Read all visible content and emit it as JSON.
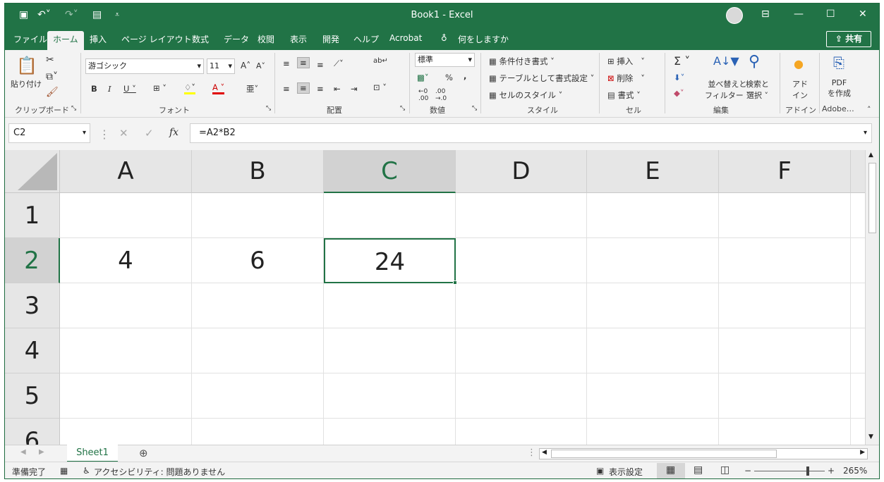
{
  "titlebar": {
    "title": "Book1 - Excel"
  },
  "menu": {
    "tabs": [
      "ファイル",
      "ホーム",
      "挿入",
      "ページ レイアウト",
      "数式",
      "データ",
      "校閲",
      "表示",
      "開発",
      "ヘルプ",
      "Acrobat"
    ],
    "tell_me": "何をしますか",
    "share": "共有"
  },
  "ribbon": {
    "clipboard": {
      "paste": "貼り付け",
      "label": "クリップボード"
    },
    "font": {
      "name": "游ゴシック",
      "size": "11",
      "label": "フォント"
    },
    "alignment": {
      "label": "配置"
    },
    "number": {
      "format": "標準",
      "label": "数値"
    },
    "styles": {
      "conditional": "条件付き書式",
      "table": "テーブルとして書式設定",
      "cell": "セルのスタイル",
      "label": "スタイル"
    },
    "cells": {
      "insert": "挿入",
      "delete": "削除",
      "format": "書式",
      "label": "セル"
    },
    "editing": {
      "sort1": "並べ替えと",
      "sort2": "フィルター",
      "find1": "検索と",
      "find2": "選択",
      "label": "編集"
    },
    "addins": {
      "line1": "アド",
      "line2": "イン",
      "label": "アドイン"
    },
    "adobe": {
      "line1": "PDF",
      "line2": "を作成",
      "label": "Adobe…"
    }
  },
  "formula_bar": {
    "name_box": "C2",
    "fx": "fx",
    "formula": "=A2*B2"
  },
  "sheet": {
    "columns": [
      "A",
      "B",
      "C",
      "D",
      "E",
      "F"
    ],
    "rows": [
      "1",
      "2",
      "3",
      "4",
      "5",
      "6"
    ],
    "cells": {
      "A2": "4",
      "B2": "6",
      "C2": "24"
    },
    "selected_cell": "C2"
  },
  "sheet_tabs": {
    "active": "Sheet1"
  },
  "status": {
    "ready": "準備完了",
    "accessibility": "アクセシビリティ: 問題ありません",
    "display_settings": "表示設定",
    "zoom": "265%"
  },
  "colors": {
    "accent": "#217346"
  }
}
